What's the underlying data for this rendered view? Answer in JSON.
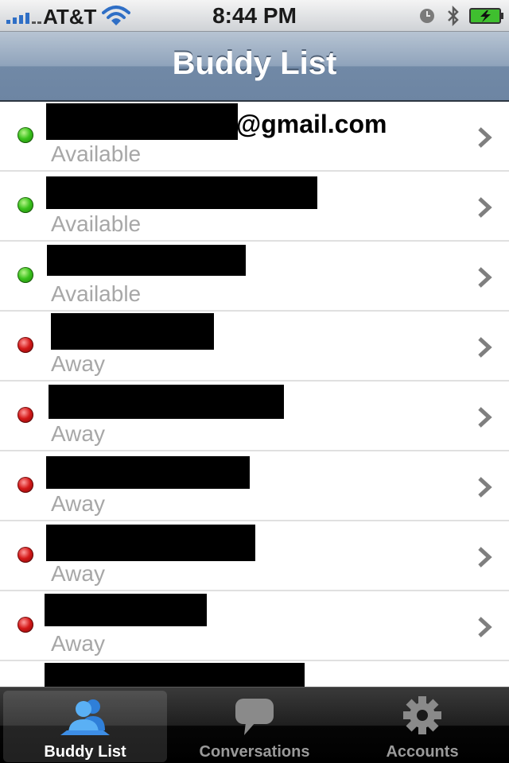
{
  "status_bar": {
    "carrier": "AT&T",
    "time": "8:44 PM",
    "icons": [
      "signal-icon",
      "wifi-icon",
      "alarm-icon",
      "bluetooth-icon",
      "battery-charging-icon"
    ]
  },
  "nav": {
    "title": "Buddy List"
  },
  "buddies": [
    {
      "status": "Available",
      "indicator": "green",
      "name_suffix": "@gmail.com"
    },
    {
      "status": "Available",
      "indicator": "green"
    },
    {
      "status": "Available",
      "indicator": "green"
    },
    {
      "status": "Away",
      "indicator": "red"
    },
    {
      "status": "Away",
      "indicator": "red"
    },
    {
      "status": "Away",
      "indicator": "red"
    },
    {
      "status": "Away",
      "indicator": "red"
    },
    {
      "status": "Away",
      "indicator": "red"
    }
  ],
  "tabs": [
    {
      "label": "Buddy List",
      "icon": "buddies-icon",
      "selected": true
    },
    {
      "label": "Conversations",
      "icon": "speech-bubble-icon",
      "selected": false
    },
    {
      "label": "Accounts",
      "icon": "gear-icon",
      "selected": false
    }
  ],
  "colors": {
    "available": "#39c21b",
    "away": "#d41818",
    "status_text": "#a7a7a7",
    "nav_bar": "#7189a6",
    "tab_accent": "#3d8ee6"
  }
}
